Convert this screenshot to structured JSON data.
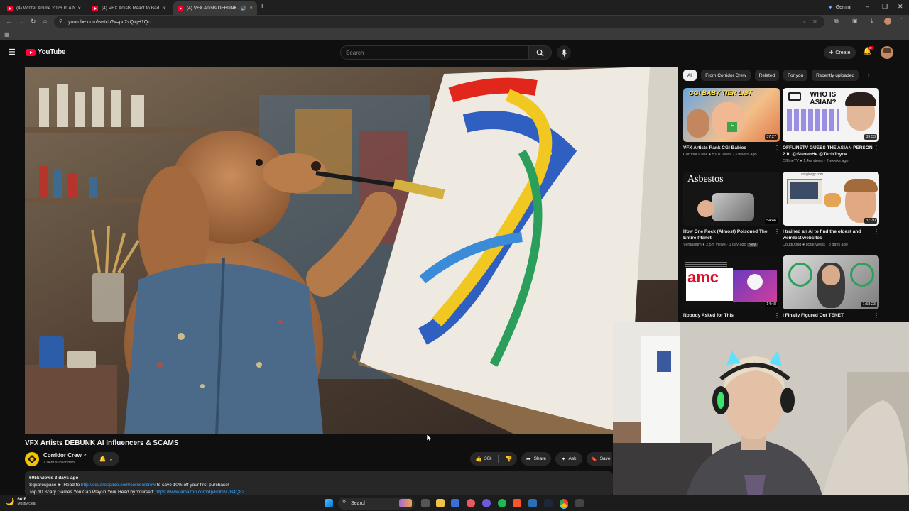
{
  "browser": {
    "tabs": [
      {
        "title": "(4) Winter Anime 2026 In A Nu"
      },
      {
        "title": "(4) VFX Artists React to Bad & G"
      },
      {
        "title": "(4) VFX Artists DEBUNK AI"
      }
    ],
    "new_tab": "+",
    "gemini_label": "Gemini",
    "url": "youtube.com/watch?v=pc2vQtqH1Qc"
  },
  "header": {
    "logo_text": "YouTube",
    "search_placeholder": "Search",
    "create_label": "Create",
    "notification_count": "9+"
  },
  "chips": [
    "All",
    "From Corridor Crew",
    "Related",
    "For you",
    "Recently uploaded"
  ],
  "recommendations": [
    {
      "title": "VFX Artists Rank CGI Babies",
      "channel": "Corridor Crew",
      "meta": "530k views · 3 weeks ago",
      "duration": "37:27",
      "thumb_text": "CGI BABY TIER LIST"
    },
    {
      "title": "OFFLINETV GUESS THE ASIAN PERSON 2 ft. @StevenHe @TechJoyce",
      "channel": "OfflineTV",
      "meta": "1.4m views · 2 weeks ago",
      "duration": "39:53",
      "thumb_text": "WHO IS ASIAN?"
    },
    {
      "title": "How One Rock (Almost) Poisoned The Entire Planet",
      "channel": "Veritasium",
      "meta": "2.5m views · 1 day ago",
      "badge": "New",
      "duration": "54:46",
      "thumb_text": "Asbestos"
    },
    {
      "title": "I trained an AI to find the oldest and weirdest websites",
      "channel": "DougDoug",
      "meta": "856k views · 8 days ago",
      "duration": "37:30",
      "thumb_text": "corgiorgy.com"
    },
    {
      "title": "Nobody Asked for This",
      "channel": "",
      "meta": "",
      "duration": "14:48",
      "thumb_text": "amc"
    },
    {
      "title": "I Finally Figured Out TENET",
      "channel": "",
      "meta": "",
      "duration": "1:58:23",
      "thumb_text": ""
    }
  ],
  "video": {
    "title": "VFX Artists DEBUNK AI Influencers & SCAMS",
    "channel": "Corridor Crew",
    "subscribers": "7.04m subscribers",
    "likes": "30k",
    "share_label": "Share",
    "ask_label": "Ask",
    "save_label": "Save",
    "views_date": "605k views  3 days ago",
    "desc_line1_prefix": "Squarespace ► Head to ",
    "desc_line1_link": "http://squarespace.com/corridorcrew",
    "desc_line1_suffix": " to save 10% off your first purchase!",
    "desc_line2_prefix": "Top 10 Scary Games You Can Play in Your Head by Yourself: ",
    "desc_line2_link": "https://www.amazon.com/dp/B0GM7B4Q82"
  },
  "taskbar": {
    "weather_temp": "66°F",
    "weather_desc": "Mostly clear",
    "search_label": "Search"
  },
  "colors": {
    "youtube_red": "#ff0033",
    "background": "#0f0f0f",
    "chip_bg": "#272727",
    "link": "#3ea6ff",
    "corridor_yellow": "#f2c400"
  }
}
